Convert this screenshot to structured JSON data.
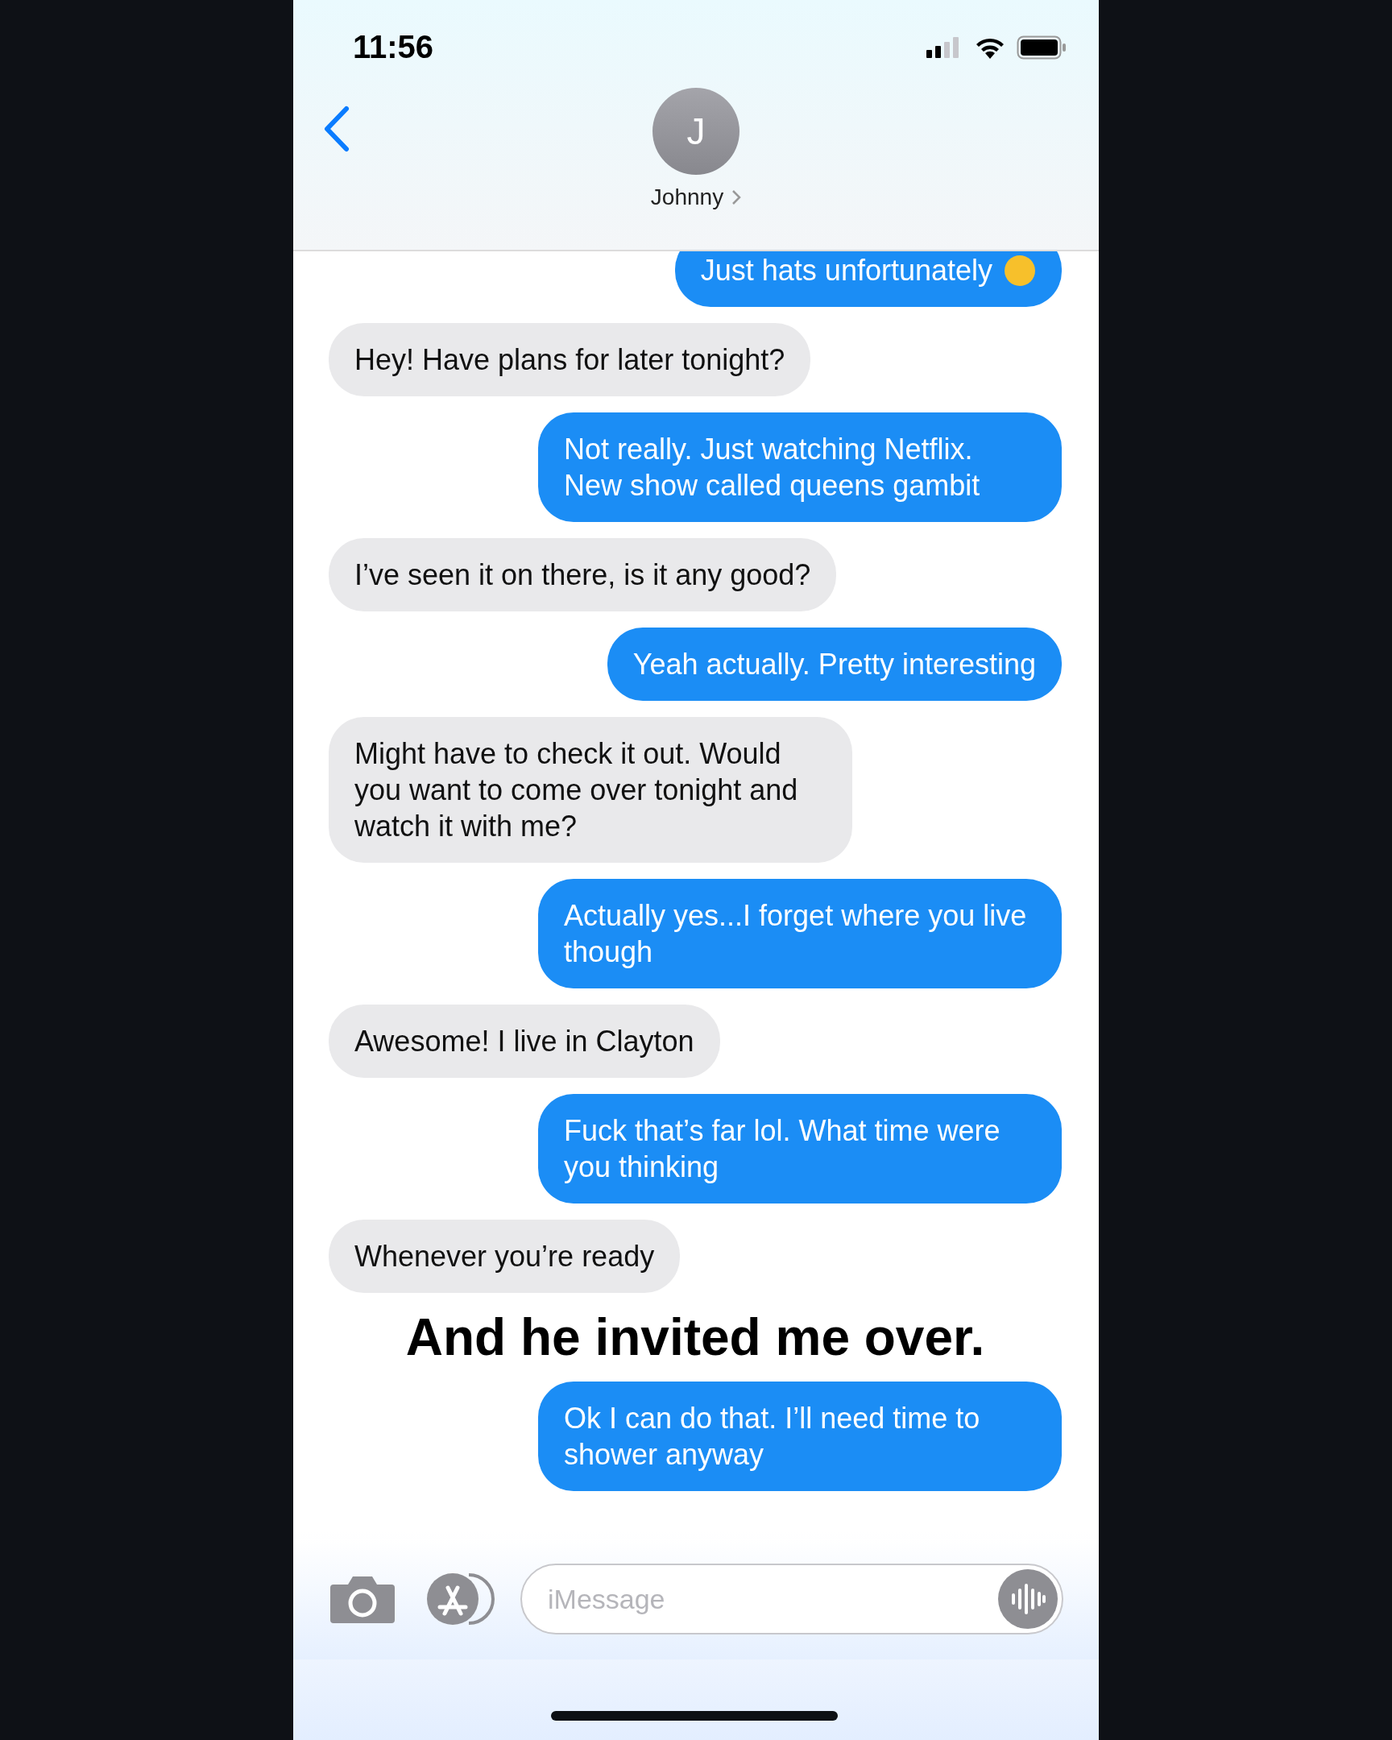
{
  "status_bar": {
    "time": "11:56"
  },
  "contact": {
    "initial": "J",
    "name": "Johnny"
  },
  "thread": [
    {
      "kind": "sent",
      "text": "Just hats unfortunately",
      "emoji": true
    },
    {
      "kind": "received",
      "text": "Hey! Have plans for later tonight?"
    },
    {
      "kind": "sent",
      "text": "Not really. Just watching Netflix. New show called queens gambit"
    },
    {
      "kind": "received",
      "text": "I’ve seen it on there, is it any good?"
    },
    {
      "kind": "sent",
      "text": "Yeah actually. Pretty interesting"
    },
    {
      "kind": "received",
      "text": "Might have to check it out. Would you want to come over tonight and watch it with me?"
    },
    {
      "kind": "sent",
      "text": "Actually yes...I forget where you live though"
    },
    {
      "kind": "received",
      "text": "Awesome! I live in Clayton"
    },
    {
      "kind": "sent",
      "text": "Fuck that’s far lol. What time were you thinking"
    },
    {
      "kind": "received",
      "text": "Whenever you’re ready"
    },
    {
      "kind": "caption",
      "text": "And he invited me over."
    },
    {
      "kind": "sent",
      "text": "Ok I can do that. I’ll need time to shower anyway"
    }
  ],
  "composer": {
    "placeholder": "iMessage"
  }
}
